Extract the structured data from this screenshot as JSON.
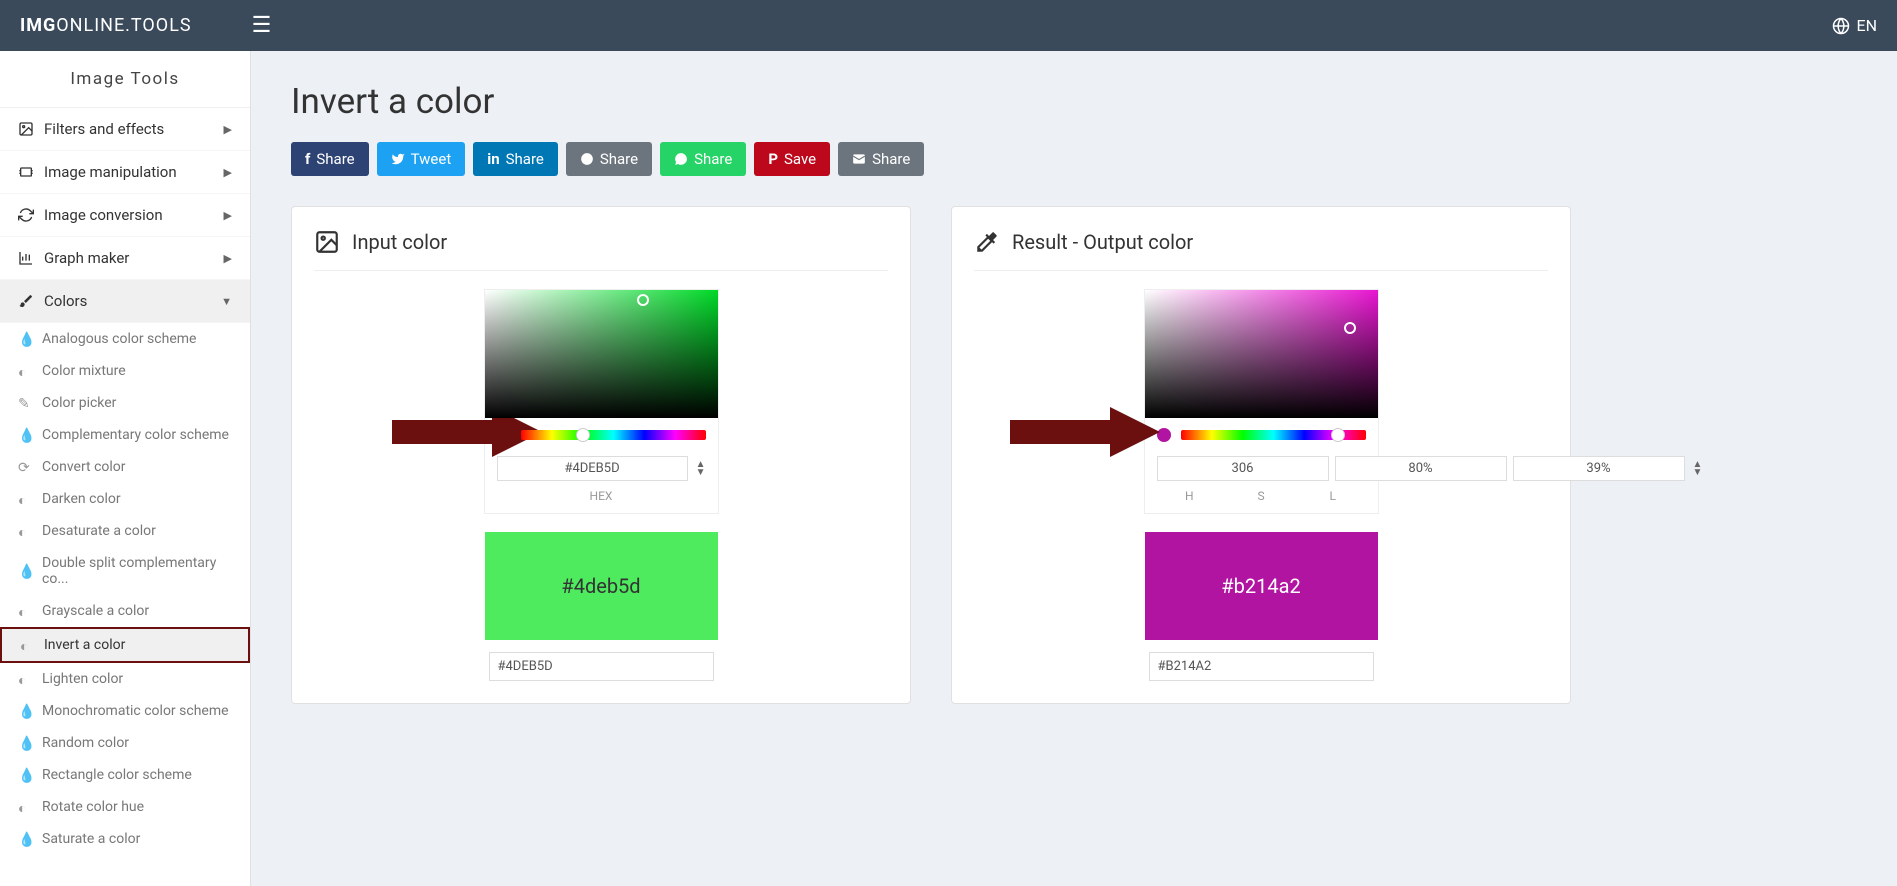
{
  "header": {
    "logo_bold": "IMG",
    "logo_rest": "ONLINE.TOOLS",
    "lang": "EN"
  },
  "sidebar": {
    "title": "Image Tools",
    "items": [
      {
        "label": "Filters and effects"
      },
      {
        "label": "Image manipulation"
      },
      {
        "label": "Image conversion"
      },
      {
        "label": "Graph maker"
      },
      {
        "label": "Colors"
      }
    ],
    "subitems": [
      {
        "label": "Analogous color scheme"
      },
      {
        "label": "Color mixture"
      },
      {
        "label": "Color picker"
      },
      {
        "label": "Complementary color scheme"
      },
      {
        "label": "Convert color"
      },
      {
        "label": "Darken color"
      },
      {
        "label": "Desaturate a color"
      },
      {
        "label": "Double split complementary co..."
      },
      {
        "label": "Grayscale a color"
      },
      {
        "label": "Invert a color"
      },
      {
        "label": "Lighten color"
      },
      {
        "label": "Monochromatic color scheme"
      },
      {
        "label": "Random color"
      },
      {
        "label": "Rectangle color scheme"
      },
      {
        "label": "Rotate color hue"
      },
      {
        "label": "Saturate a color"
      }
    ]
  },
  "page": {
    "title": "Invert a color"
  },
  "share": {
    "fb": "Share",
    "tw": "Tweet",
    "li": "Share",
    "rd": "Share",
    "wa": "Share",
    "pi": "Save",
    "em": "Share"
  },
  "input_panel": {
    "title": "Input color",
    "hex_value": "#4DEB5D",
    "hex_label": "HEX",
    "swatch_text": "#4deb5d",
    "result_value": "#4DEB5D"
  },
  "output_panel": {
    "title": "Result - Output color",
    "h": "306",
    "s": "80%",
    "l": "39%",
    "h_label": "H",
    "s_label": "S",
    "l_label": "L",
    "swatch_text": "#b214a2",
    "result_value": "#B214A2"
  }
}
